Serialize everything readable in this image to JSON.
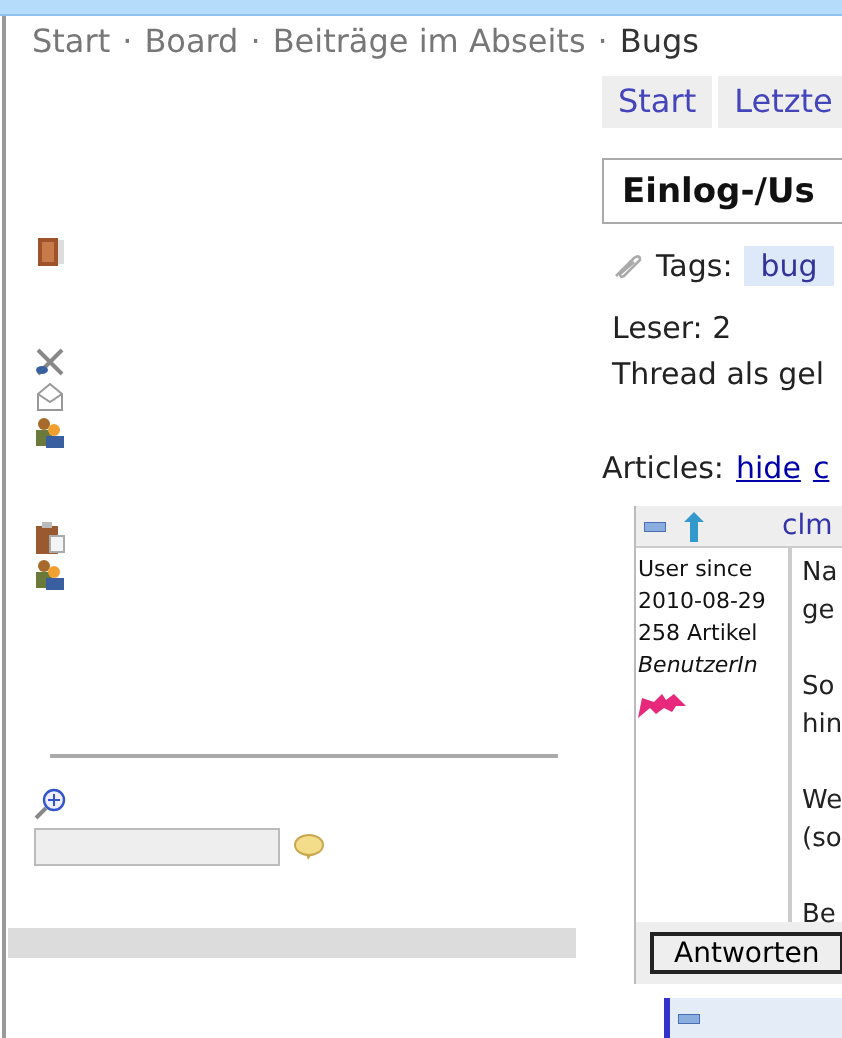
{
  "breadcrumb": [
    {
      "label": "Start",
      "current": false
    },
    {
      "label": "Board",
      "current": false
    },
    {
      "label": "Beiträge im Abseits",
      "current": false
    },
    {
      "label": "Bugs",
      "current": true
    }
  ],
  "breadcrumb_separator": "·",
  "nav_tabs": [
    {
      "label": "Start"
    },
    {
      "label": "Letzte"
    }
  ],
  "thread_title": "Einlog-/Us",
  "tags_label": "Tags:",
  "tags": [
    "bug"
  ],
  "readers": "Leser: 2",
  "thread_note": "Thread als gel",
  "articles_label": "Articles:",
  "articles_links": [
    "hide",
    "c"
  ],
  "article": {
    "author": "clm",
    "user_since": "User since",
    "date": "2010-08-29",
    "count": "258 Artikel",
    "role": "BenutzerIn",
    "body": [
      [
        "Na",
        "ge"
      ],
      [
        "So",
        "hin"
      ],
      [
        "We",
        "(so"
      ],
      [
        "Be"
      ]
    ],
    "reply_button": "Antworten"
  }
}
